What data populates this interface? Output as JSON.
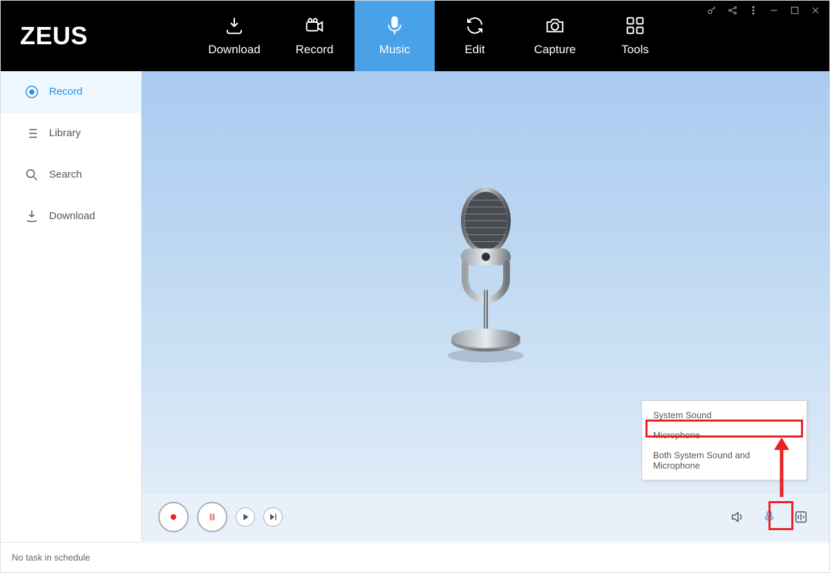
{
  "app_title": "ZEUS",
  "header_tabs": [
    {
      "label": "Download"
    },
    {
      "label": "Record"
    },
    {
      "label": "Music"
    },
    {
      "label": "Edit"
    },
    {
      "label": "Capture"
    },
    {
      "label": "Tools"
    }
  ],
  "active_header_tab": 2,
  "sidebar": {
    "items": [
      {
        "label": "Record"
      },
      {
        "label": "Library"
      },
      {
        "label": "Search"
      },
      {
        "label": "Download"
      }
    ],
    "active_index": 0
  },
  "popup": {
    "items": [
      {
        "label": "System Sound"
      },
      {
        "label": "Microphone"
      },
      {
        "label": "Both System Sound and Microphone"
      }
    ],
    "highlighted_index": 0
  },
  "status_text": "No task in schedule",
  "colors": {
    "accent": "#49a1e8",
    "annotation": "#ec2024"
  }
}
